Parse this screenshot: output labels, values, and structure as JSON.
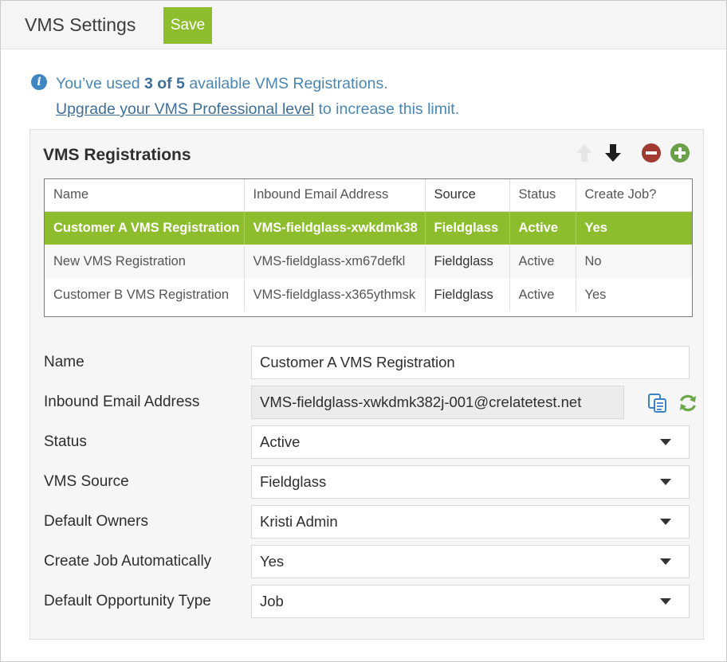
{
  "header": {
    "title": "VMS Settings",
    "save_label": "Save"
  },
  "info": {
    "prefix": "You’ve used ",
    "count": "3 of 5",
    "suffix": " available VMS Registrations.",
    "upgrade_link": "Upgrade your VMS Professional level",
    "upgrade_suffix": " to increase this limit."
  },
  "registrations": {
    "title": "VMS Registrations",
    "columns": [
      "Name",
      "Inbound Email Address",
      "Source",
      "Status",
      "Create Job?"
    ],
    "rows": [
      {
        "name": "Customer A VMS Registration",
        "email": "VMS-fieldglass-xwkdmk38",
        "source": "Fieldglass",
        "status": "Active",
        "create_job": "Yes"
      },
      {
        "name": "New VMS Registration",
        "email": "VMS-fieldglass-xm67defkl",
        "source": "Fieldglass",
        "status": "Active",
        "create_job": "No"
      },
      {
        "name": "Customer B VMS Registration",
        "email": "VMS-fieldglass-x365ythmsk",
        "source": "Fieldglass",
        "status": "Active",
        "create_job": "Yes"
      }
    ],
    "selected_row": 0
  },
  "form": {
    "name_label": "Name",
    "name_value": "Customer A VMS Registration",
    "email_label": "Inbound Email Address",
    "email_value": "VMS-fieldglass-xwkdmk382j-001@crelatetest.net",
    "status_label": "Status",
    "status_value": "Active",
    "source_label": "VMS Source",
    "source_value": "Fieldglass",
    "owners_label": "Default Owners",
    "owners_value": "Kristi Admin",
    "create_job_label": "Create Job Automatically",
    "create_job_value": "Yes",
    "opp_type_label": "Default Opportunity Type",
    "opp_type_value": "Job"
  },
  "icons": {
    "info": "info-icon",
    "move_up": "arrow-up-icon",
    "move_down": "arrow-down-icon",
    "remove": "minus-circle-icon",
    "add": "plus-circle-icon",
    "copy": "copy-icon",
    "regenerate": "refresh-icon"
  },
  "colors": {
    "accent": "#8dbd2d",
    "info_text": "#4a86b3",
    "remove": "#a03a32",
    "add": "#6aa04a"
  }
}
